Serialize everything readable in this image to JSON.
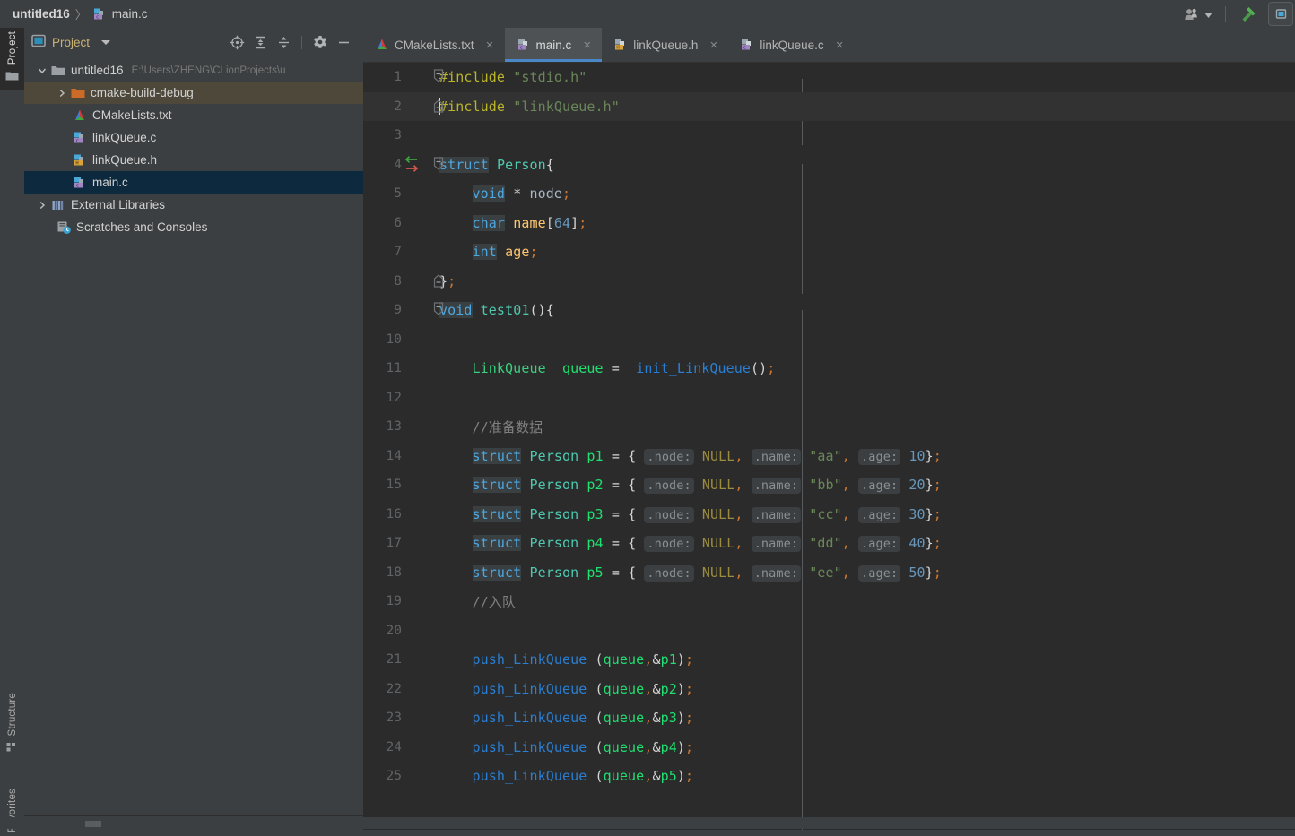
{
  "titlebar": {
    "project_name": "untitled16",
    "separator": "〉",
    "file_name": "main.c",
    "icons": {
      "user": "user-avatar-icon",
      "dropdown": "chevron-down-icon",
      "build": "hammer-build-icon",
      "run_widget": "run-configuration-icon"
    }
  },
  "left_strip": {
    "project": "Project",
    "structure": "Structure",
    "favorites": "Favorites"
  },
  "project_panel": {
    "title": "Project",
    "toolbar": [
      {
        "name": "scroll-from-source-icon",
        "label": "Select Opened File"
      },
      {
        "name": "expand-all-icon",
        "label": "Expand All"
      },
      {
        "name": "collapse-all-icon",
        "label": "Collapse All"
      },
      {
        "name": "settings-gear-icon",
        "label": "Options"
      },
      {
        "name": "hide-panel-icon",
        "label": "Hide"
      }
    ],
    "tree": [
      {
        "label": "untitled16",
        "sub": "E:\\Users\\ZHENG\\CLionProjects\\u",
        "icon": "folder-module-icon",
        "arrow": "expanded",
        "indent": 0,
        "state": "normal"
      },
      {
        "label": "cmake-build-debug",
        "sub": "",
        "icon": "folder-excluded-icon",
        "arrow": "collapsed",
        "indent": 1,
        "state": "hover"
      },
      {
        "label": "CMakeLists.txt",
        "sub": "",
        "icon": "cmake-file-icon",
        "arrow": "none",
        "indent": 1,
        "state": "normal"
      },
      {
        "label": "linkQueue.c",
        "sub": "",
        "icon": "c-source-file-icon",
        "arrow": "none",
        "indent": 1,
        "state": "normal"
      },
      {
        "label": "linkQueue.h",
        "sub": "",
        "icon": "c-header-file-icon",
        "arrow": "none",
        "indent": 1,
        "state": "normal"
      },
      {
        "label": "main.c",
        "sub": "",
        "icon": "c-source-file-icon",
        "arrow": "none",
        "indent": 1,
        "state": "selected"
      },
      {
        "label": "External Libraries",
        "sub": "",
        "icon": "libraries-icon",
        "arrow": "collapsed",
        "indent": 0,
        "state": "normal"
      },
      {
        "label": "Scratches and Consoles",
        "sub": "",
        "icon": "scratches-icon",
        "arrow": "none",
        "indent": 0,
        "state": "normal"
      }
    ]
  },
  "editor": {
    "tabs": [
      {
        "label": "CMakeLists.txt",
        "icon": "cmake-file-icon",
        "active": false,
        "close": "×"
      },
      {
        "label": "main.c",
        "icon": "c-source-file-icon",
        "active": true,
        "close": "×"
      },
      {
        "label": "linkQueue.h",
        "icon": "c-header-file-icon",
        "active": false,
        "close": "×"
      },
      {
        "label": "linkQueue.c",
        "icon": "c-source-file-icon",
        "active": false,
        "close": "×"
      }
    ],
    "active_tab": "main.c",
    "caret_line": 2,
    "first_visible_line": 1,
    "last_visible_line": 25,
    "lines": [
      {
        "n": 1,
        "text": "#include \"stdio.h\""
      },
      {
        "n": 2,
        "text": "#include \"linkQueue.h\""
      },
      {
        "n": 3,
        "text": ""
      },
      {
        "n": 4,
        "text": "struct Person{"
      },
      {
        "n": 5,
        "text": "    void * node;"
      },
      {
        "n": 6,
        "text": "    char name[64];"
      },
      {
        "n": 7,
        "text": "    int age;"
      },
      {
        "n": 8,
        "text": "};"
      },
      {
        "n": 9,
        "text": "void test01(){"
      },
      {
        "n": 10,
        "text": ""
      },
      {
        "n": 11,
        "text": "    LinkQueue  queue =  init_LinkQueue();"
      },
      {
        "n": 12,
        "text": ""
      },
      {
        "n": 13,
        "text": "    //准备数据"
      },
      {
        "n": 14,
        "text": "    struct Person p1 = { NULL, \"aa\", 10};"
      },
      {
        "n": 15,
        "text": "    struct Person p2 = { NULL, \"bb\", 20};"
      },
      {
        "n": 16,
        "text": "    struct Person p3 = { NULL, \"cc\", 30};"
      },
      {
        "n": 17,
        "text": "    struct Person p4 = { NULL, \"dd\", 40};"
      },
      {
        "n": 18,
        "text": "    struct Person p5 = { NULL, \"ee\", 50};"
      },
      {
        "n": 19,
        "text": "    //入队"
      },
      {
        "n": 20,
        "text": ""
      },
      {
        "n": 21,
        "text": "    push_LinkQueue (queue,&p1);"
      },
      {
        "n": 22,
        "text": "    push_LinkQueue (queue,&p2);"
      },
      {
        "n": 23,
        "text": "    push_LinkQueue (queue,&p3);"
      },
      {
        "n": 24,
        "text": "    push_LinkQueue (queue,&p4);"
      },
      {
        "n": 25,
        "text": "    push_LinkQueue (queue,&p5);"
      }
    ],
    "tokens": {
      "include": "#include",
      "stdio": "\"stdio.h\"",
      "linkqueue_h": "\"linkQueue.h\"",
      "kw_struct": "struct",
      "kw_void": "void",
      "kw_char": "char",
      "kw_int": "int",
      "type_person": "Person",
      "field_node": "node",
      "field_name": "name",
      "field_age": "age",
      "arr_size": "64",
      "fn_test01": "test01",
      "type_linkqueue": "LinkQueue",
      "var_queue": "queue",
      "fn_init": "init_LinkQueue",
      "fn_push": "push_LinkQueue",
      "macro_null": "NULL",
      "comment_prepare": "//准备数据",
      "comment_enqueue": "//入队",
      "vars": [
        "p1",
        "p2",
        "p3",
        "p4",
        "p5"
      ],
      "names": [
        "\"aa\"",
        "\"bb\"",
        "\"cc\"",
        "\"dd\"",
        "\"ee\""
      ],
      "ages": [
        "10",
        "20",
        "30",
        "40",
        "50"
      ],
      "hints": {
        "node": ".node:",
        "name": ".name:",
        "age": ".age:"
      }
    },
    "gutter_markers": [
      {
        "line": 4,
        "name": "implemented-overridden-arrows-icon"
      }
    ],
    "fold_markers": [
      {
        "line": 1,
        "state": "expanded"
      },
      {
        "line": 2,
        "state": "expanded-end"
      },
      {
        "line": 4,
        "state": "expanded"
      },
      {
        "line": 8,
        "state": "expanded-end"
      },
      {
        "line": 9,
        "state": "expanded"
      }
    ]
  },
  "colors": {
    "chrome_bg": "#3c3f41",
    "editor_bg": "#2b2b2b",
    "current_line_bg": "#323232",
    "selection_bg": "#0d293e",
    "hover_bg": "#4e483a",
    "tab_active_bg": "#4e5254",
    "tab_active_underline": "#4a88c7",
    "keyword": "#4ca7e0",
    "preprocessor": "#bbb529",
    "string": "#6a8759",
    "comment": "#808080",
    "number": "#6897bb",
    "function": "#ffc66d",
    "type": "#4ec9b0",
    "macro": "#9b8b3e",
    "punctuation": "#cc7832",
    "gutter_number": "#606366",
    "panel_title": "#c8b273"
  }
}
